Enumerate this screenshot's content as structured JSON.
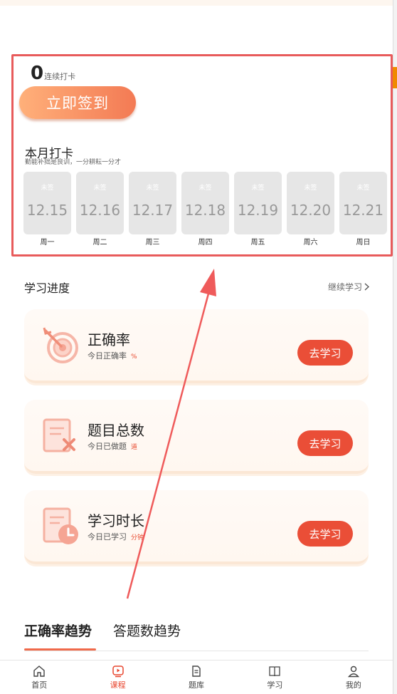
{
  "checkin": {
    "streak_count": "0",
    "streak_label": "连续打卡",
    "signin_label": "立即签到",
    "month_title": "本月打卡",
    "month_subtitle": "勤能补拙是良训，一分耕耘一分才",
    "days": [
      {
        "status": "未签",
        "date": "12.15",
        "weekday": "周一"
      },
      {
        "status": "未签",
        "date": "12.16",
        "weekday": "周二"
      },
      {
        "status": "未签",
        "date": "12.17",
        "weekday": "周三"
      },
      {
        "status": "未签",
        "date": "12.18",
        "weekday": "周四"
      },
      {
        "status": "未签",
        "date": "12.19",
        "weekday": "周五"
      },
      {
        "status": "未签",
        "date": "12.20",
        "weekday": "周六"
      },
      {
        "status": "未签",
        "date": "12.21",
        "weekday": "周日"
      }
    ]
  },
  "progress": {
    "title": "学习进度",
    "continue_label": "继续学习",
    "cards": [
      {
        "title": "正确率",
        "subtitle": "今日正确率",
        "unit": "%",
        "button": "去学习",
        "icon": "target-icon"
      },
      {
        "title": "题目总数",
        "subtitle": "今日已做题",
        "unit": "道",
        "button": "去学习",
        "icon": "wrong-questions-icon"
      },
      {
        "title": "学习时长",
        "subtitle": "今日已学习",
        "unit": "分钟",
        "button": "去学习",
        "icon": "clock-icon"
      }
    ]
  },
  "trends": {
    "tabs": [
      "正确率趋势",
      "答题数趋势"
    ],
    "active": "正确率趋势"
  },
  "nav": {
    "items": [
      {
        "label": "首页",
        "icon": "home-icon"
      },
      {
        "label": "课程",
        "icon": "course-icon"
      },
      {
        "label": "题库",
        "icon": "question-bank-icon"
      },
      {
        "label": "学习",
        "icon": "book-icon"
      },
      {
        "label": "我的",
        "icon": "profile-icon"
      }
    ],
    "active": "课程"
  },
  "colors": {
    "accent": "#ea4e37",
    "highlight_border": "#e85b5b",
    "signin_gradient_start": "#ffb07a",
    "signin_gradient_end": "#f37a54",
    "day_box": "#e6e6e6"
  }
}
